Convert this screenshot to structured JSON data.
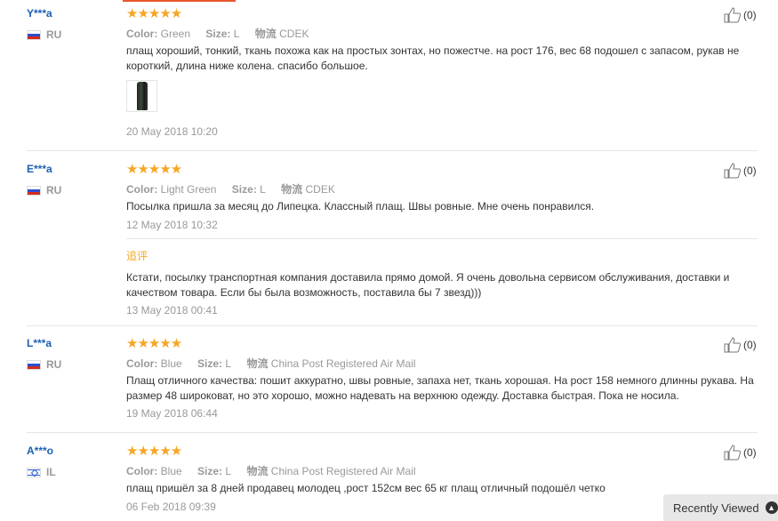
{
  "recently_viewed": {
    "label": "Recently Viewed",
    "icon": "chevron-up-icon"
  },
  "reviews": [
    {
      "user": "Y***a",
      "country": "RU",
      "stars": "★★★★★",
      "color_label": "Color:",
      "color_value": "Green",
      "size_label": "Size:",
      "size_value": "L",
      "shipping_label": "物流",
      "shipping_value": "CDEK",
      "text": "плащ хороший, тонкий, ткань похожа как на простых зонтах, но пожестче. на рост 176, вес 68 подошел с запасом, рукав не короткий, длина ниже колена. спасибо большое.",
      "date": "20 May 2018 10:20",
      "likes": "(0)"
    },
    {
      "user": "E***a",
      "country": "RU",
      "stars": "★★★★★",
      "color_label": "Color:",
      "color_value": "Light Green",
      "size_label": "Size:",
      "size_value": "L",
      "shipping_label": "物流",
      "shipping_value": "CDEK",
      "text": "Посылка пришла за месяц до Липецка. Классный плащ. Швы ровные. Мне очень понравился.",
      "date": "12 May 2018 10:32",
      "followup_label": "追评",
      "followup_text": "Кстати, посылку транспортная компания доставила прямо домой. Я очень довольна сервисом обслуживания, доставки и качеством товара. Если бы была возможность, поставила бы 7 звезд)))",
      "followup_date": "13 May 2018 00:41",
      "likes": "(0)"
    },
    {
      "user": "L***a",
      "country": "RU",
      "stars": "★★★★★",
      "color_label": "Color:",
      "color_value": "Blue",
      "size_label": "Size:",
      "size_value": "L",
      "shipping_label": "物流",
      "shipping_value": "China Post Registered Air Mail",
      "text": "Плащ отличного качества: пошит аккуратно, швы ровные, запаха нет, ткань хорошая. На рост 158 немного длинны рукава. На размер 48 широковат, но это хорошо, можно надевать на верхнюю одежду. Доставка быстрая. Пока не носила.",
      "date": "19 May 2018 06:44",
      "likes": "(0)"
    },
    {
      "user": "A***o",
      "country": "IL",
      "stars": "★★★★★",
      "color_label": "Color:",
      "color_value": "Blue",
      "size_label": "Size:",
      "size_value": "L",
      "shipping_label": "物流",
      "shipping_value": "China Post Registered Air Mail",
      "text": "плащ пришёл за 8 дней продавец молодец ,рост 152см вес 65 кг плащ отличный подошёл четко",
      "date": "06 Feb 2018 09:39",
      "likes": "(0)"
    }
  ],
  "colors": {
    "accent": "#f5a623",
    "link": "#1a5fb4",
    "muted": "#999999"
  }
}
